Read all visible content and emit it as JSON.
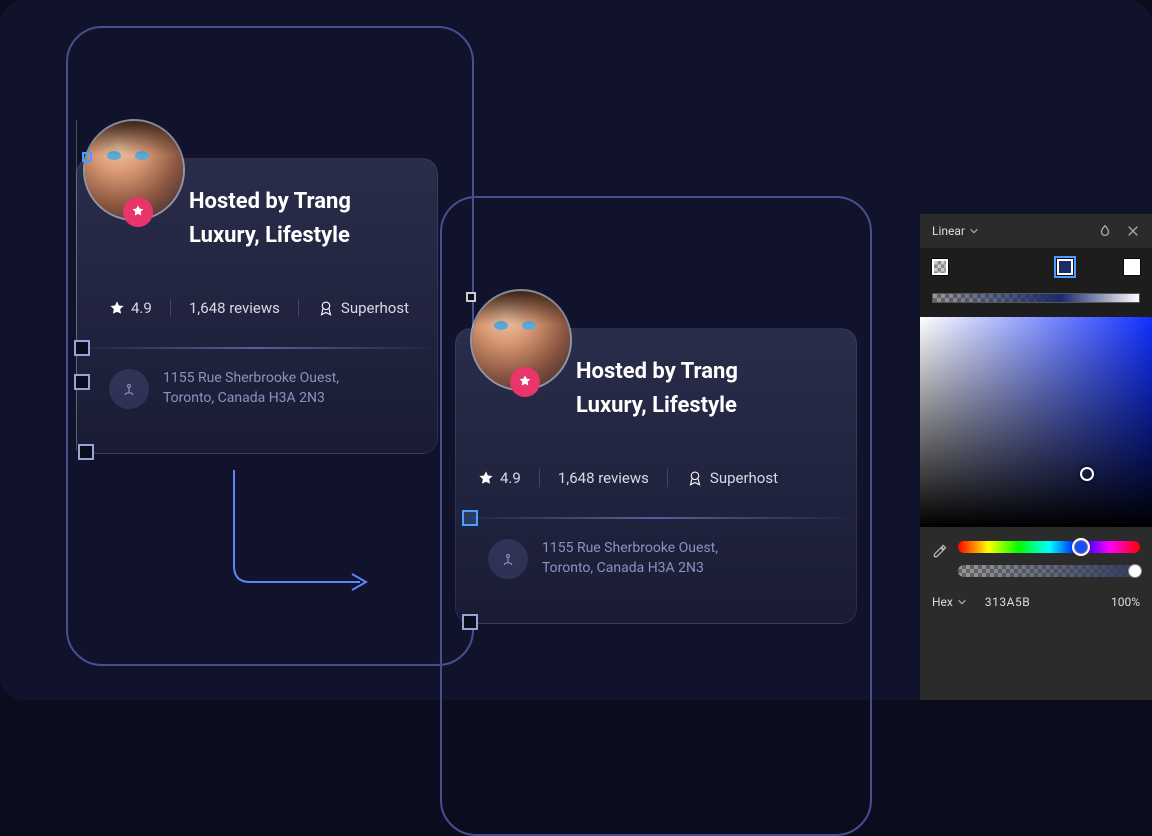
{
  "host": {
    "title_line1": "Hosted by Trang",
    "title_line2": "Luxury, Lifestyle",
    "rating": "4.9",
    "reviews": "1,648 reviews",
    "superhost": "Superhost",
    "address_line1": "1155 Rue Sherbrooke Ouest,",
    "address_line2": "Toronto, Canada H3A 2N3"
  },
  "color_picker": {
    "mode": "Linear",
    "format_label": "Hex",
    "hex": "313A5B",
    "opacity": "100%"
  }
}
